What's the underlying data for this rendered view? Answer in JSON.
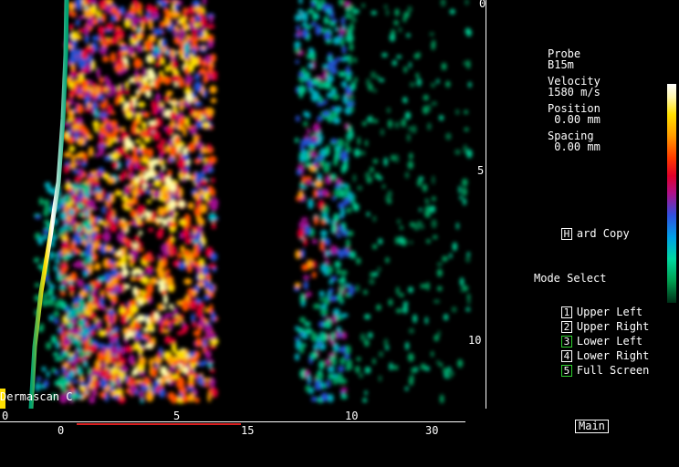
{
  "scan": {
    "watermark": "Dermascan C"
  },
  "depth_axis": {
    "ticks": [
      "0",
      "5",
      "10"
    ]
  },
  "horizontal_axis": {
    "upper_ticks": [
      "0",
      "5",
      "10"
    ],
    "lower_ticks": [
      "0",
      "15",
      "30"
    ]
  },
  "info": {
    "probe_label": "Probe",
    "probe_value": "B15m",
    "velocity_label": "Velocity",
    "velocity_value": "1580 m/s",
    "position_label": "Position",
    "position_value": " 0.00 mm",
    "spacing_label": "Spacing",
    "spacing_value": " 0.00 mm"
  },
  "hard_copy": {
    "key": "H",
    "label": "ard Copy"
  },
  "mode_select": {
    "title": "Mode Select",
    "items": [
      {
        "key": "1",
        "label": "Upper Left"
      },
      {
        "key": "2",
        "label": "Upper Right"
      },
      {
        "key": "3",
        "label": "Lower Left"
      },
      {
        "key": "4",
        "label": "Lower Right"
      },
      {
        "key": "5",
        "label": "Full Screen"
      }
    ]
  },
  "main_button": {
    "label": "Main"
  },
  "colors": {
    "accent_green": "#2fd02f",
    "red_marker": "#d82020"
  }
}
